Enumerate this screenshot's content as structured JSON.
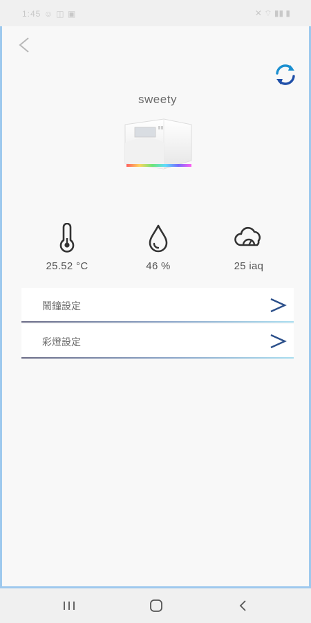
{
  "status_bar": {
    "time": "1:45 ☺ ◫ ▣",
    "indicators": "✕ ⌔ ▮▮ ▮"
  },
  "header": {
    "back_icon": "chevron-left-icon",
    "refresh_icon": "refresh-icon"
  },
  "device": {
    "name": "sweety"
  },
  "sensors": [
    {
      "icon": "thermometer-icon",
      "value": "25.52 °C"
    },
    {
      "icon": "water-drop-icon",
      "value": "46 %"
    },
    {
      "icon": "cloud-gauge-icon",
      "value": "25 iaq"
    }
  ],
  "menu": [
    {
      "label": "鬧鐘設定"
    },
    {
      "label": "彩燈設定"
    }
  ],
  "colors": {
    "accent_blue": "#1f5fb3",
    "chevron_navy": "#2b4f8a",
    "frame_border": "#9ec9ee",
    "divider_start": "#6a6b86",
    "divider_end": "#a8ddef"
  },
  "nav_bar": {
    "recent_icon": "recent-apps-icon",
    "home_icon": "home-icon",
    "back_icon": "back-icon"
  }
}
